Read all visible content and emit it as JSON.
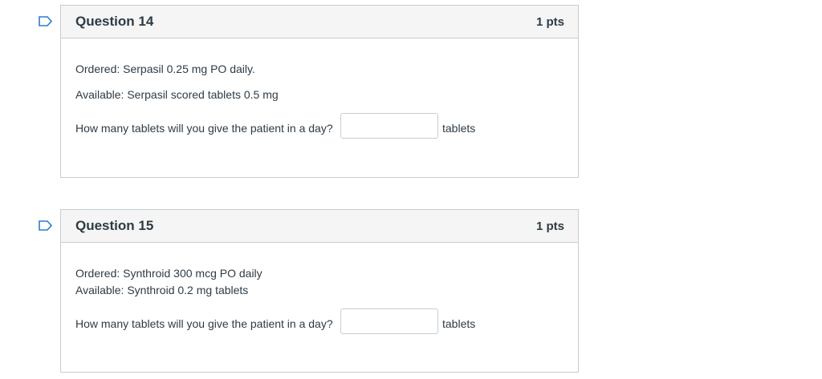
{
  "questions": [
    {
      "title": "Question 14",
      "points": "1 pts",
      "lines": [
        "Ordered: Serpasil 0.25 mg PO daily.",
        "Available:  Serpasil scored tablets 0.5 mg"
      ],
      "prompt": "How many tablets will you give the patient in a day?",
      "answer_value": "",
      "unit": "tablets"
    },
    {
      "title": "Question 15",
      "points": "1 pts",
      "lines": [
        "Ordered: Synthroid 300 mcg PO daily",
        "Available: Synthroid 0.2 mg tablets"
      ],
      "prompt": "How many tablets will you give the patient in a day?",
      "answer_value": "",
      "unit": "tablets"
    }
  ],
  "icons": {
    "flag": "bookmark-flag-icon"
  },
  "colors": {
    "flag_outline": "#2d7bd0",
    "border": "#c7cdd1",
    "header_bg": "#f5f5f5"
  }
}
